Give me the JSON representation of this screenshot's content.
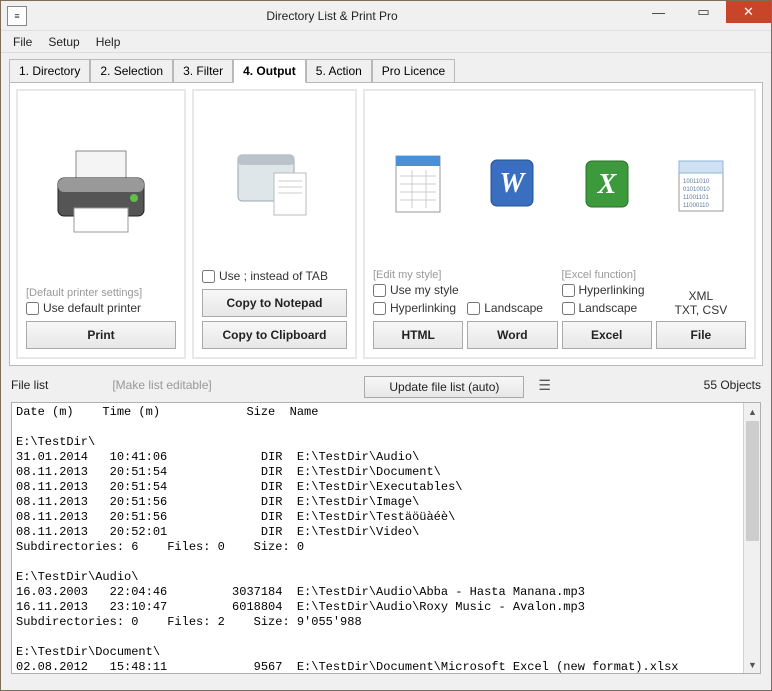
{
  "window": {
    "title": "Directory List & Print Pro"
  },
  "menu": {
    "file": "File",
    "setup": "Setup",
    "help": "Help"
  },
  "tabs": {
    "t1": "1. Directory",
    "t2": "2. Selection",
    "t3": "3. Filter",
    "t4": "4. Output",
    "t5": "5. Action",
    "t6": "Pro Licence"
  },
  "printCol": {
    "hint": "[Default printer settings]",
    "chk": "Use default printer",
    "btn": "Print"
  },
  "copyCol": {
    "chk": "Use  ;  instead of TAB",
    "btn1": "Copy to Notepad",
    "btn2": "Copy to Clipboard"
  },
  "htmlCol": {
    "hint": "[Edit my style]",
    "chk1": "Use my style",
    "chk2": "Hyperlinking",
    "btn": "HTML"
  },
  "wordCol": {
    "chk": "Landscape",
    "btn": "Word"
  },
  "excelCol": {
    "hint": "[Excel function]",
    "chk1": "Hyperlinking",
    "chk2": "Landscape",
    "btn": "Excel"
  },
  "fileCol": {
    "l1": "XML",
    "l2": "TXT, CSV",
    "btn": "File"
  },
  "listHeader": {
    "l1": "File list",
    "l2": "[Make list editable]",
    "btn": "Update file list (auto)",
    "count": "55 Objects"
  },
  "listing": {
    "header": "Date (m)    Time (m)            Size  Name",
    "root": "E:\\TestDir\\",
    "rows1": [
      "31.01.2014   10:41:06             DIR  E:\\TestDir\\Audio\\",
      "08.11.2013   20:51:54             DIR  E:\\TestDir\\Document\\",
      "08.11.2013   20:51:54             DIR  E:\\TestDir\\Executables\\",
      "08.11.2013   20:51:56             DIR  E:\\TestDir\\Image\\",
      "08.11.2013   20:51:56             DIR  E:\\TestDir\\Testäöüàéè\\",
      "08.11.2013   20:52:01             DIR  E:\\TestDir\\Video\\"
    ],
    "sum1": "Subdirectories: 6    Files: 0    Size: 0",
    "sec2": "E:\\TestDir\\Audio\\",
    "rows2": [
      "16.03.2003   22:04:46         3037184  E:\\TestDir\\Audio\\Abba - Hasta Manana.mp3",
      "16.11.2013   23:10:47         6018804  E:\\TestDir\\Audio\\Roxy Music - Avalon.mp3"
    ],
    "sum2": "Subdirectories: 0    Files: 2    Size: 9'055'988",
    "sec3": "E:\\TestDir\\Document\\",
    "rows3": [
      "02.08.2012   15:48:11            9567  E:\\TestDir\\Document\\Microsoft Excel (new format).xlsx"
    ]
  }
}
